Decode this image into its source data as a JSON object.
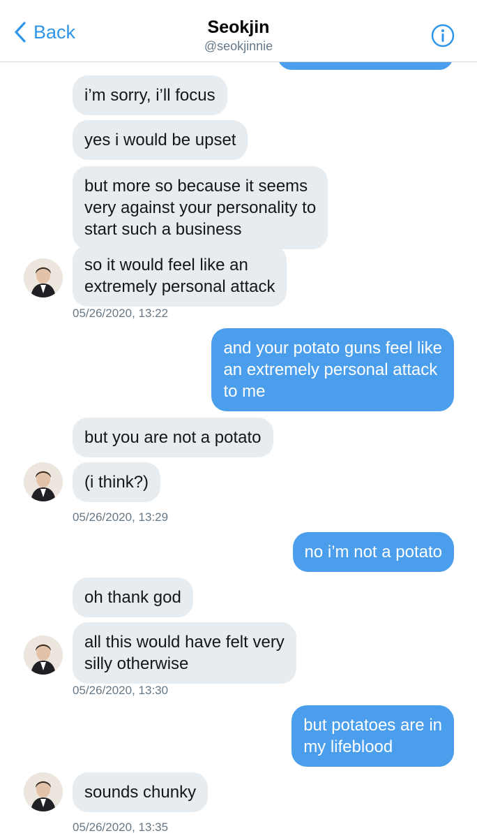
{
  "header": {
    "back_label": "Back",
    "title": "Seokjin",
    "handle": "@seokjinnie"
  },
  "colors": {
    "accent": "#2f95ea",
    "sent_bubble": "#4a9eec",
    "received_bubble": "#e6ecf0",
    "timestamp": "#657786"
  },
  "messages": [
    {
      "from": "them",
      "text": "i’m sorry, i’ll focus"
    },
    {
      "from": "them",
      "text": "yes i would be upset"
    },
    {
      "from": "them",
      "lines": [
        "but more so because it seems",
        "very against your personality to",
        "start such a business"
      ]
    },
    {
      "from": "them",
      "lines": [
        "so it would feel like an",
        "extremely personal attack"
      ]
    },
    {
      "from": "me",
      "lines": [
        "and your potato guns feel like",
        "an extremely personal attack",
        "to me"
      ]
    },
    {
      "from": "them",
      "text": "but you are not a potato"
    },
    {
      "from": "them",
      "text": "(i think?)"
    },
    {
      "from": "me",
      "text": "no i’m not a potato"
    },
    {
      "from": "them",
      "text": "oh thank god"
    },
    {
      "from": "them",
      "lines": [
        "all this would have felt very",
        "silly otherwise"
      ]
    },
    {
      "from": "me",
      "lines": [
        "but potatoes are in",
        "my lifeblood"
      ]
    },
    {
      "from": "them",
      "text": "sounds chunky"
    }
  ],
  "timestamps": [
    "05/26/2020, 13:22",
    "05/26/2020, 13:29",
    "05/26/2020, 13:30",
    "05/26/2020, 13:35"
  ],
  "icons": {
    "back": "chevron-left-icon",
    "info": "info-icon",
    "avatar": "contact-avatar"
  }
}
